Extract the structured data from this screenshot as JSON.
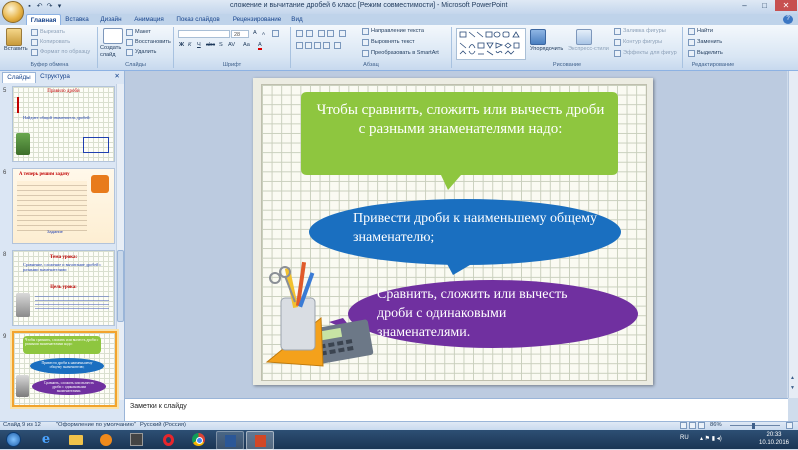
{
  "window": {
    "title": "сложение и вычитание дробей 6 класс [Режим совместимости] - Microsoft PowerPoint",
    "controls": [
      "–",
      "□",
      "✕"
    ]
  },
  "tabs": [
    "Главная",
    "Вставка",
    "Дизайн",
    "Анимация",
    "Показ слайдов",
    "Рецензирование",
    "Вид"
  ],
  "ribbon": {
    "clipboard": {
      "paste": "Вставить",
      "cut": "Вырезать",
      "copy": "Копировать",
      "format_painter": "Формат по образцу",
      "label": "Буфер обмена"
    },
    "slides": {
      "new_slide": "Создать слайд",
      "layout": "Макет",
      "reset": "Восстановить",
      "delete": "Удалить",
      "label": "Слайды"
    },
    "font": {
      "font_name": "",
      "font_size": "28",
      "label": "Шрифт",
      "bold": "Ж",
      "italic": "К",
      "underline": "Ч",
      "strike": "abc",
      "shadow": "S",
      "spacing": "AV",
      "case": "Aa",
      "color": "A",
      "grow": "A",
      "shrink": "A"
    },
    "paragraph": {
      "text_direction": "Направление текста",
      "align_text": "Выровнять текст",
      "smartart": "Преобразовать в SmartArt",
      "label": "Абзац"
    },
    "drawing": {
      "arrange": "Упорядочить",
      "quick_styles": "Экспресс-стили",
      "fill": "Заливка фигуры",
      "outline": "Контур фигуры",
      "effects": "Эффекты для фигур",
      "label": "Рисование"
    },
    "editing": {
      "find": "Найти",
      "replace": "Заменить",
      "select": "Выделить",
      "label": "Редактирование"
    }
  },
  "left_panel": {
    "tabs": [
      "Слайды",
      "Структура"
    ],
    "thumbnails": [
      {
        "number": "5",
        "title": "Правило дроби",
        "lines": [
          "Найдите общий знаменатель дробей:"
        ]
      },
      {
        "number": "6",
        "title": "А теперь решим задачу",
        "lines": [
          "Задание"
        ]
      },
      {
        "number": "8",
        "title": "Тема урока:",
        "lines": [
          "Сравнение, сложение и вычитание дробей с разными знаменателями",
          "Цель урока:"
        ]
      },
      {
        "number": "9",
        "title": "",
        "lines": [
          "Чтобы сравнить, сложить или вычесть дроби с разными знаменателями надо:",
          "Привести дроби к наименьшему общему знаменателю;",
          "Сравнить, сложить или вычесть дроби с одинаковыми знаменателями."
        ]
      }
    ]
  },
  "slide": {
    "callout_1": "Чтобы сравнить, сложить или вычесть дроби с разными знаменателями надо:",
    "callout_2": "Привести дроби к наименьшему общему знаменателю;",
    "callout_3": "Сравнить, сложить или вычесть дроби с одинаковыми знаменателями.",
    "colors": {
      "green": "#8ec63f",
      "blue": "#1a6fc0",
      "purple": "#7030a0"
    }
  },
  "notes": {
    "placeholder": "Заметки к слайду"
  },
  "status": {
    "slide_info": "Слайд 9 из 12",
    "theme": "\"Оформление по умолчанию\"",
    "language": "Русский (Россия)",
    "zoom": "86%"
  },
  "taskbar": {
    "language": "RU",
    "time": "20:33",
    "date": "10.10.2016"
  }
}
